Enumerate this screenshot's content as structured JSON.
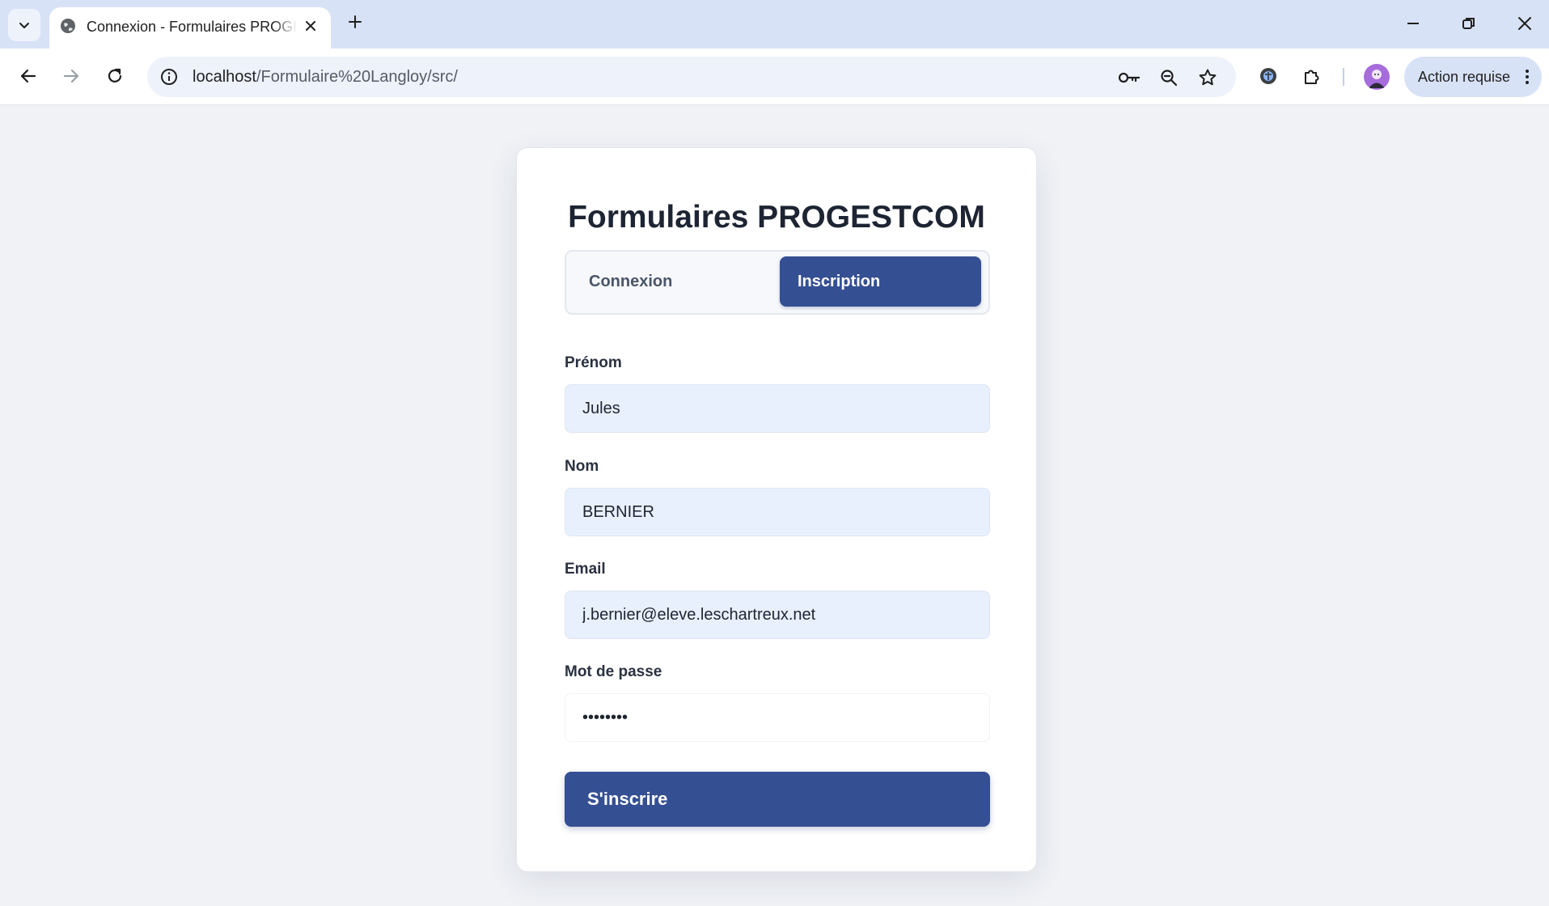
{
  "browser": {
    "tab": {
      "title": "Connexion - Formulaires PROGESTCOM",
      "favicon": "globe-icon"
    },
    "address_bar": {
      "host": "localhost",
      "path": "/Formulaire%20Langloy/src/",
      "info_icon": "info-icon"
    },
    "omnibox_icons": [
      "key-icon",
      "zoom-out-icon",
      "star-icon"
    ],
    "toolbar_icons": [
      "extension-shield-icon",
      "puzzle-icon"
    ],
    "profile": {
      "avatar": "avatar",
      "action_label": "Action requise"
    }
  },
  "page": {
    "title": "Formulaires PROGESTCOM",
    "tabs": [
      {
        "label": "Connexion",
        "active": false
      },
      {
        "label": "Inscription",
        "active": true
      }
    ],
    "form": {
      "fields": [
        {
          "label": "Prénom",
          "value": "Jules",
          "type": "text"
        },
        {
          "label": "Nom",
          "value": "BERNIER",
          "type": "text"
        },
        {
          "label": "Email",
          "value": "j.bernier@eleve.leschartreux.net",
          "type": "email"
        },
        {
          "label": "Mot de passe",
          "value": "password",
          "type": "password"
        }
      ],
      "submit_label": "S'inscrire"
    }
  },
  "colors": {
    "primary": "#354f93",
    "autofill_bg": "#e8f0fe",
    "page_bg": "#f0f2f6",
    "tabstrip_bg": "#d8e2f7"
  }
}
